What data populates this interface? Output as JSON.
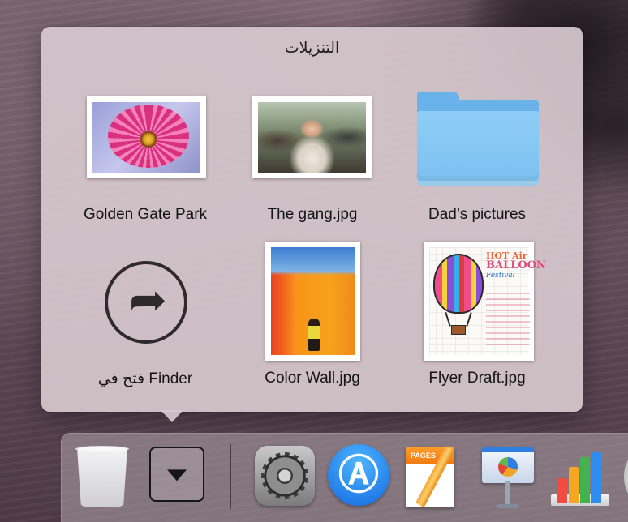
{
  "stack": {
    "title": "التنزيلات",
    "items": [
      {
        "label": "Golden Gate Park",
        "kind": "image",
        "icon": "photo-flower"
      },
      {
        "label": "The gang.jpg",
        "kind": "image",
        "icon": "photo-group"
      },
      {
        "label": "Dad’s pictures",
        "kind": "folder",
        "icon": "folder-icon"
      },
      {
        "label": "فتح في Finder",
        "kind": "action",
        "icon": "open-in-finder-arrow-icon"
      },
      {
        "label": "Color Wall.jpg",
        "kind": "image",
        "icon": "photo-color-wall"
      },
      {
        "label": "Flyer Draft.jpg",
        "kind": "image",
        "icon": "photo-flyer"
      }
    ]
  },
  "flyer_thumbnail_text": {
    "line1": "HOT Air",
    "line2": "BALLOON",
    "line3": "Festival"
  },
  "dock": {
    "items": [
      {
        "name": "trash",
        "icon": "trash-icon"
      },
      {
        "name": "downloads-stack",
        "icon": "downloads-stack-icon"
      },
      {
        "name": "system-preferences",
        "icon": "gear-icon"
      },
      {
        "name": "app-store",
        "icon": "app-store-icon"
      },
      {
        "name": "pages",
        "icon": "pages-icon",
        "badge": "PAGES"
      },
      {
        "name": "keynote",
        "icon": "keynote-icon"
      },
      {
        "name": "numbers",
        "icon": "numbers-icon"
      }
    ]
  },
  "colors": {
    "popover_bg": "#d6c8ce",
    "folder_blue": "#7cc0f0",
    "app_store_blue": "#1268e0"
  }
}
